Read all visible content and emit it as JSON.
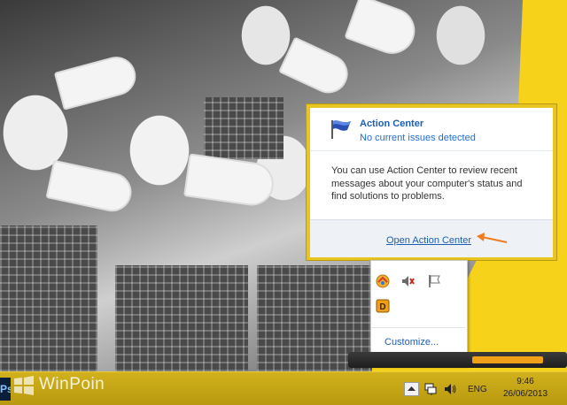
{
  "action_center": {
    "title": "Action Center",
    "status": "No current issues detected",
    "description": "You can use Action Center to review recent messages about your computer's status and find solutions to problems.",
    "link": "Open Action Center"
  },
  "tray_panel": {
    "icons": [
      "flash-sync-icon",
      "speaker-muted-icon",
      "flag-icon",
      "daemon-tools-icon"
    ],
    "customize": "Customize..."
  },
  "taskbar": {
    "left_button_text": "Ps",
    "watermark": "WinPoin",
    "language": "ENG",
    "time": "9:46",
    "date": "26/06/2013"
  },
  "colors": {
    "accent_yellow": "#f6d21a",
    "link_blue": "#1b5fb5",
    "arrow_orange": "#f07a1c"
  }
}
